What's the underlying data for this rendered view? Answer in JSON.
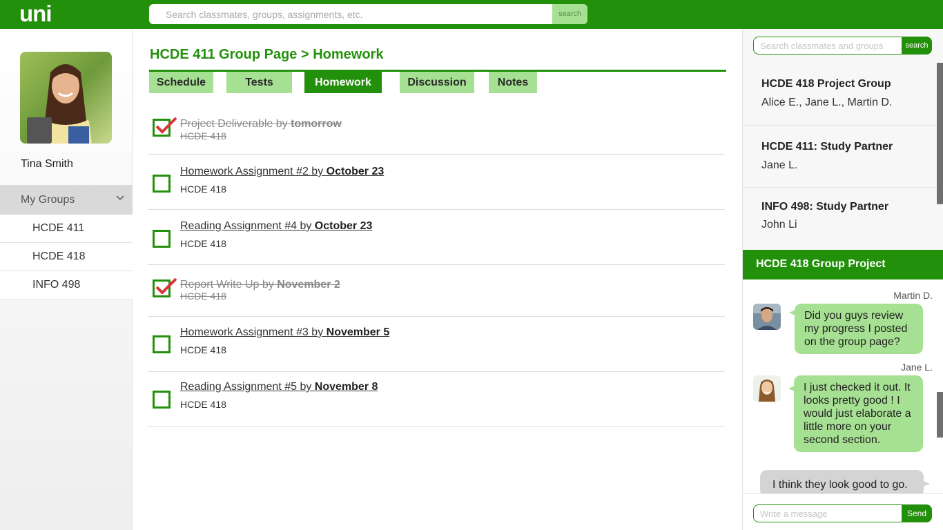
{
  "app": {
    "logo": "uni"
  },
  "top_search": {
    "placeholder": "Search classmates, groups, assignments, etc.",
    "button": "search"
  },
  "profile": {
    "name": "Tina Smith"
  },
  "sidebar": {
    "groups_label": "My Groups",
    "groups": [
      "HCDE 411",
      "HCDE 418",
      "INFO 498"
    ]
  },
  "main": {
    "title": "HCDE 411 Group Page > Homework",
    "tabs": [
      {
        "label": "Schedule",
        "active": false
      },
      {
        "label": "Tests",
        "active": false
      },
      {
        "label": "Homework",
        "active": true
      },
      {
        "label": "Discussion",
        "active": false
      },
      {
        "label": "Notes",
        "active": false
      }
    ],
    "homework": [
      {
        "title": "Project Deliverable by ",
        "due": "tomorrow",
        "course": "HCDE 418",
        "done": true
      },
      {
        "title": "Homework Assignment #2 by ",
        "due": "October 23",
        "course": "HCDE 418",
        "done": false
      },
      {
        "title": "Reading Assignment #4 by ",
        "due": "October 23",
        "course": "HCDE 418",
        "done": false
      },
      {
        "title": "Report Write Up by ",
        "due": "November 2",
        "course": "HCDE 418",
        "done": true
      },
      {
        "title": "Homework Assignment #3 by ",
        "due": "November 5",
        "course": "HCDE 418",
        "done": false
      },
      {
        "title": "Reading Assignment #5 by ",
        "due": "November 8",
        "course": "HCDE 418",
        "done": false
      }
    ]
  },
  "right_panel": {
    "search": {
      "placeholder": "Search classmates and groups",
      "button": "search"
    },
    "contacts": [
      {
        "title": "HCDE 418 Project Group",
        "subtitle": "Alice E., Jane L., Martin D."
      },
      {
        "title": "HCDE 411: Study Partner",
        "subtitle": "Jane L."
      },
      {
        "title": "INFO 498: Study Partner",
        "subtitle": "John Li"
      }
    ],
    "chat": {
      "title": "HCDE 418 Group Project",
      "messages": [
        {
          "sender": "Martin D.",
          "text": "Did you guys review my progress I posted on the group page?"
        },
        {
          "sender": "Jane L.",
          "text": "I just checked it out. It looks pretty good ! I would just elaborate a little more on your second section."
        },
        {
          "sender": "",
          "text": "I think they look good to go."
        }
      ],
      "input_placeholder": "Write a message",
      "send_label": "Send"
    }
  },
  "colors": {
    "brand": "#23900b",
    "light_green": "#a6e092",
    "check_red": "#d9343a"
  }
}
